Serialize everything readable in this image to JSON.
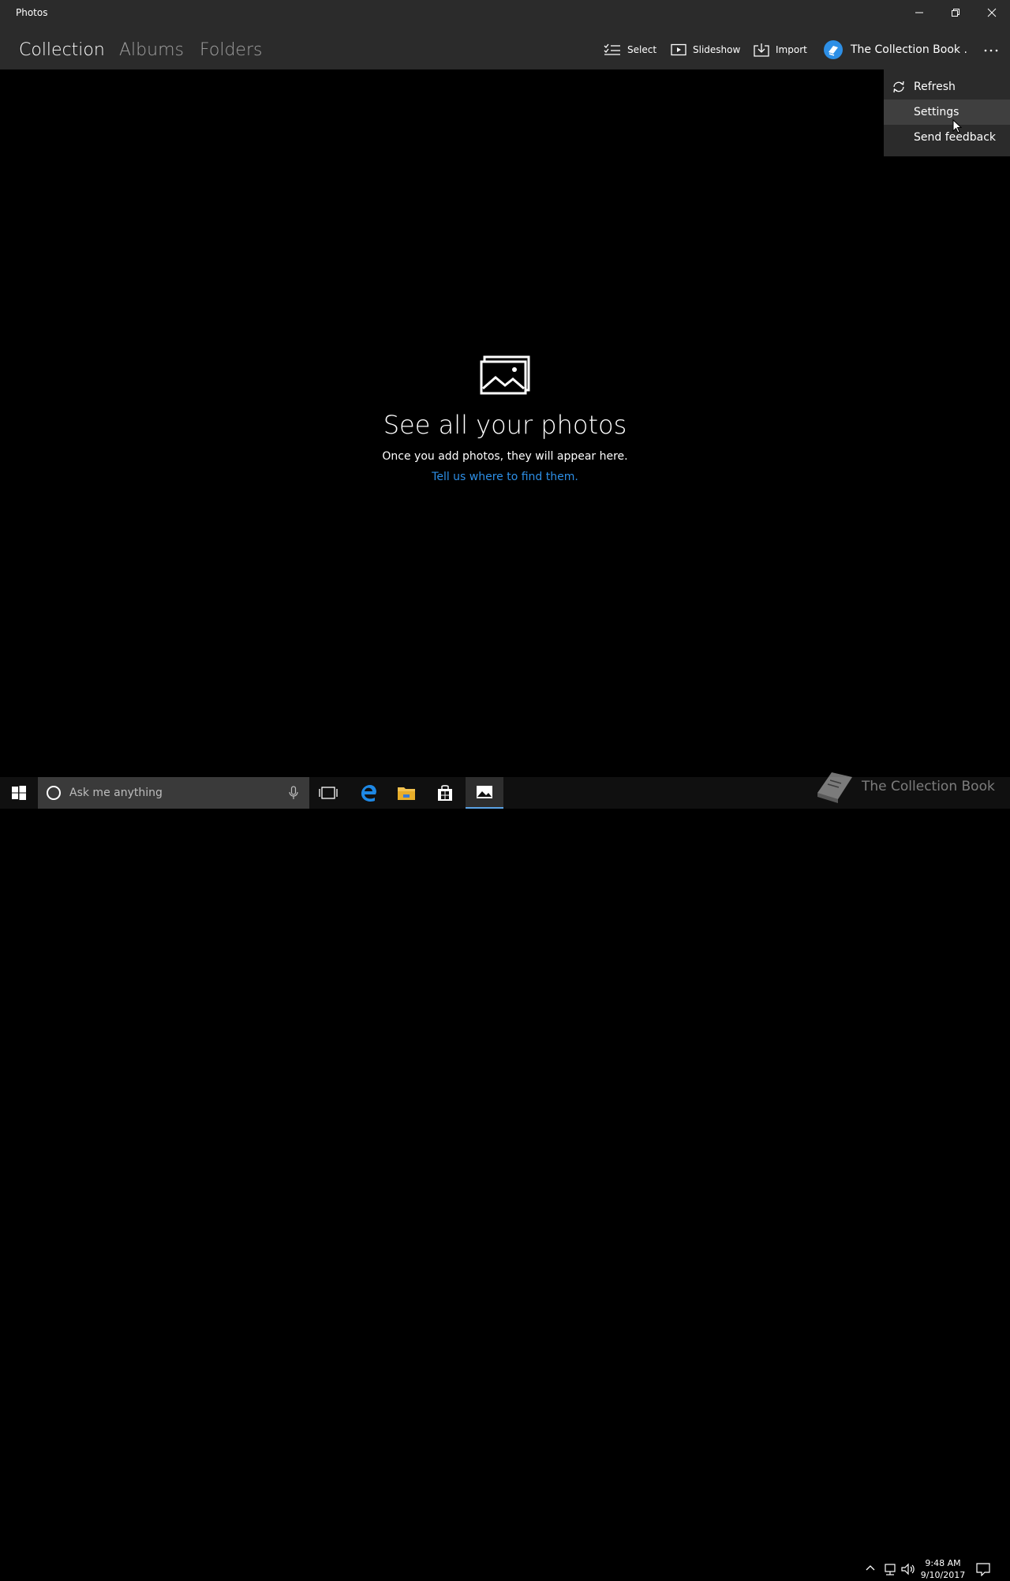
{
  "window": {
    "title": "Photos"
  },
  "nav": {
    "tabs": [
      {
        "label": "Collection",
        "active": true
      },
      {
        "label": "Albums",
        "active": false
      },
      {
        "label": "Folders",
        "active": false
      }
    ]
  },
  "commands": {
    "select": "Select",
    "slideshow": "Slideshow",
    "import": "Import",
    "account": "The Collection Book ."
  },
  "menu": {
    "items": [
      {
        "label": "Refresh",
        "icon": "refresh-icon"
      },
      {
        "label": "Settings"
      },
      {
        "label": "Send feedback"
      }
    ]
  },
  "empty_state": {
    "title": "See all your photos",
    "subtitle": "Once you add photos, they will appear here.",
    "link": "Tell us where to find them."
  },
  "taskbar": {
    "search_placeholder": "Ask me anything",
    "watermark": "The Collection Book",
    "time": "9:48 AM",
    "date": "9/10/2017"
  },
  "colors": {
    "accent": "#2d8fe6",
    "chrome": "#2b2b2b",
    "background": "#000000"
  }
}
